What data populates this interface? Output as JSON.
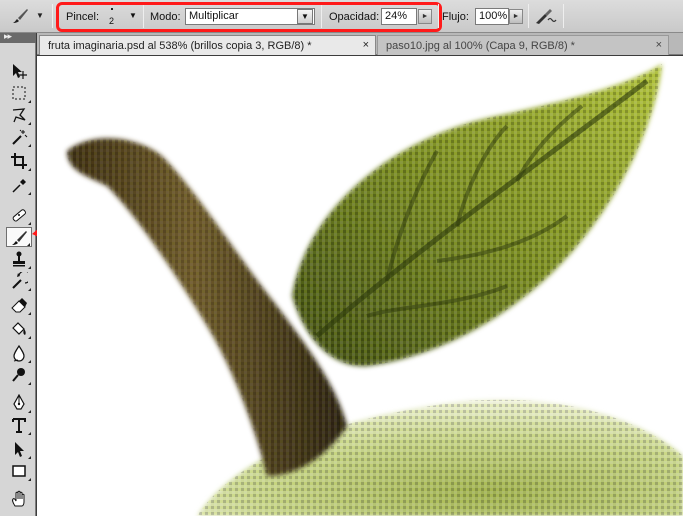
{
  "options_bar": {
    "pincel_label": "Pincel:",
    "brush_size": "2",
    "modo_label": "Modo:",
    "modo_value": "Multiplicar",
    "opacidad_label": "Opacidad:",
    "opacidad_value": "24%",
    "flujo_label": "Flujo:",
    "flujo_value": "100%"
  },
  "document_tabs": [
    {
      "label": "fruta imaginaria.psd al 538% (brillos copia 3, RGB/8) *",
      "close": "×",
      "active": true
    },
    {
      "label": "paso10.jpg al 100% (Capa 9, RGB/8) *",
      "close": "×",
      "active": false
    }
  ],
  "tools": [
    {
      "name": "move-tool",
      "icon": "move-icon"
    },
    {
      "name": "marquee-tool",
      "icon": "marquee-icon"
    },
    {
      "name": "lasso-tool",
      "icon": "lasso-icon"
    },
    {
      "name": "magic-wand-tool",
      "icon": "magic-wand-icon"
    },
    {
      "name": "crop-tool",
      "icon": "crop-icon"
    },
    {
      "name": "eyedropper-tool",
      "icon": "eyedropper-icon"
    },
    {
      "name": "healing-brush-tool",
      "icon": "bandage-icon"
    },
    {
      "name": "brush-tool",
      "icon": "brush-icon",
      "active": true
    },
    {
      "name": "clone-stamp-tool",
      "icon": "stamp-icon"
    },
    {
      "name": "history-brush-tool",
      "icon": "history-brush-icon"
    },
    {
      "name": "eraser-tool",
      "icon": "eraser-icon"
    },
    {
      "name": "paint-bucket-tool",
      "icon": "paint-bucket-icon"
    },
    {
      "name": "blur-tool",
      "icon": "blur-icon"
    },
    {
      "name": "dodge-tool",
      "icon": "dodge-icon"
    },
    {
      "name": "pen-tool",
      "icon": "pen-icon"
    },
    {
      "name": "type-tool",
      "icon": "type-icon"
    },
    {
      "name": "path-selection-tool",
      "icon": "arrow-icon"
    },
    {
      "name": "shape-tool",
      "icon": "rectangle-icon"
    },
    {
      "name": "hand-tool",
      "icon": "hand-icon"
    }
  ],
  "colors": {
    "highlight": "#ff1a1a",
    "stem": "#5a4a22",
    "leaf": "#6f7f22",
    "apple": "#c9d690"
  }
}
